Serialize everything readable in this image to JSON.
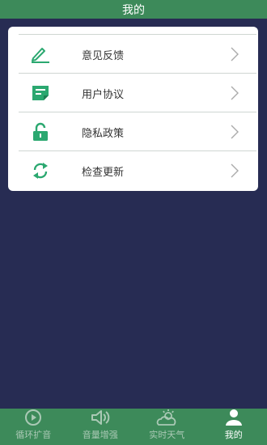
{
  "header": {
    "title": "我的"
  },
  "menu": {
    "items": [
      {
        "label": "意见反馈",
        "icon": "edit-icon"
      },
      {
        "label": "用户协议",
        "icon": "document-icon"
      },
      {
        "label": "隐私政策",
        "icon": "lock-icon"
      },
      {
        "label": "检查更新",
        "icon": "refresh-icon"
      }
    ]
  },
  "tabbar": {
    "tabs": [
      {
        "label": "循环扩音",
        "icon": "play-circle-icon",
        "active": false
      },
      {
        "label": "音量增强",
        "icon": "speaker-icon",
        "active": false
      },
      {
        "label": "实时天气",
        "icon": "weather-icon",
        "active": false
      },
      {
        "label": "我的",
        "icon": "user-icon",
        "active": true
      }
    ]
  },
  "colors": {
    "accent": "#3d8a5a",
    "icon_green": "#2ba870",
    "background": "#272c53",
    "card": "#ffffff"
  }
}
